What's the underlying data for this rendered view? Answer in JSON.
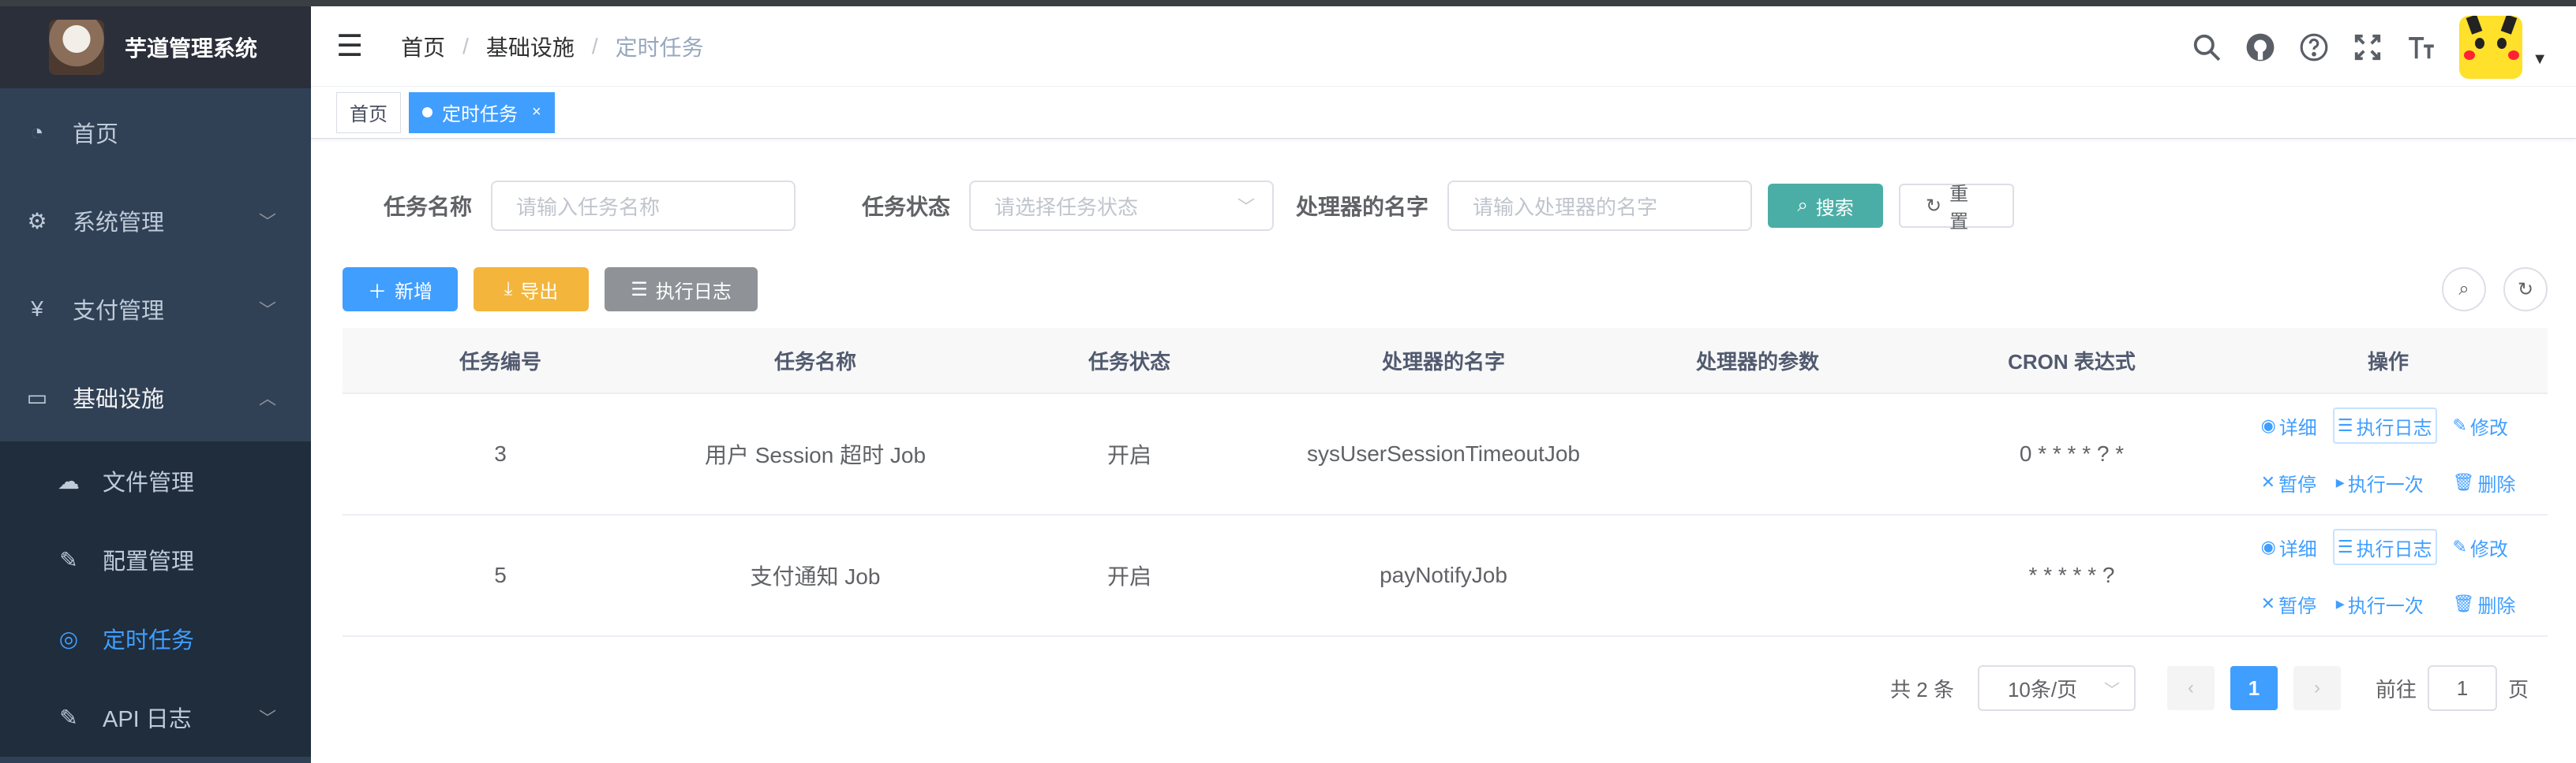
{
  "app": {
    "title": "芋道管理系统"
  },
  "sidebar": {
    "items": [
      {
        "label": "首页",
        "icon": "dashboard-icon",
        "glyph": "◔"
      },
      {
        "label": "系统管理",
        "icon": "gear-icon",
        "glyph": "⚙"
      },
      {
        "label": "支付管理",
        "icon": "yen-icon",
        "glyph": "¥"
      },
      {
        "label": "基础设施",
        "icon": "monitor-icon",
        "glyph": "▭"
      }
    ],
    "subitems": [
      {
        "label": "文件管理",
        "icon": "cloud-upload-icon",
        "glyph": "☁"
      },
      {
        "label": "配置管理",
        "icon": "edit-icon",
        "glyph": "✎"
      },
      {
        "label": "定时任务",
        "icon": "job-icon",
        "glyph": "◎",
        "active": true
      },
      {
        "label": "API 日志",
        "icon": "log-icon",
        "glyph": "✎"
      }
    ]
  },
  "breadcrumb": [
    "首页",
    "基础设施",
    "定时任务"
  ],
  "tags": {
    "home": "首页",
    "current": "定时任务",
    "close": "×"
  },
  "search": {
    "name_label": "任务名称",
    "name_placeholder": "请输入任务名称",
    "status_label": "任务状态",
    "status_placeholder": "请选择任务状态",
    "handler_label": "处理器的名字",
    "handler_placeholder": "请输入处理器的名字",
    "search_btn": "搜索",
    "reset_btn": "重置"
  },
  "toolbar": {
    "add": "新增",
    "export": "导出",
    "log": "执行日志"
  },
  "table": {
    "headers": [
      "任务编号",
      "任务名称",
      "任务状态",
      "处理器的名字",
      "处理器的参数",
      "CRON 表达式",
      "操作"
    ],
    "rows": [
      {
        "id": "3",
        "name": "用户 Session 超时 Job",
        "status": "开启",
        "handler": "sysUserSessionTimeoutJob",
        "param": "",
        "cron": "0 * * * * ? *"
      },
      {
        "id": "5",
        "name": "支付通知 Job",
        "status": "开启",
        "handler": "payNotifyJob",
        "param": "",
        "cron": "* * * * * ?"
      }
    ],
    "ops": {
      "detail": "详细",
      "log": "执行日志",
      "edit": "修改",
      "pause": "暂停",
      "run_once": "执行一次",
      "delete": "删除"
    }
  },
  "pagination": {
    "total": "共 2 条",
    "size": "10条/页",
    "current": "1",
    "goto_prefix": "前往",
    "goto_value": "1",
    "goto_suffix": "页"
  },
  "colors": {
    "primary": "#409eff",
    "sidebar": "#304156",
    "search": "#4aaea6",
    "export": "#f3b53c",
    "log": "#8f9397"
  }
}
